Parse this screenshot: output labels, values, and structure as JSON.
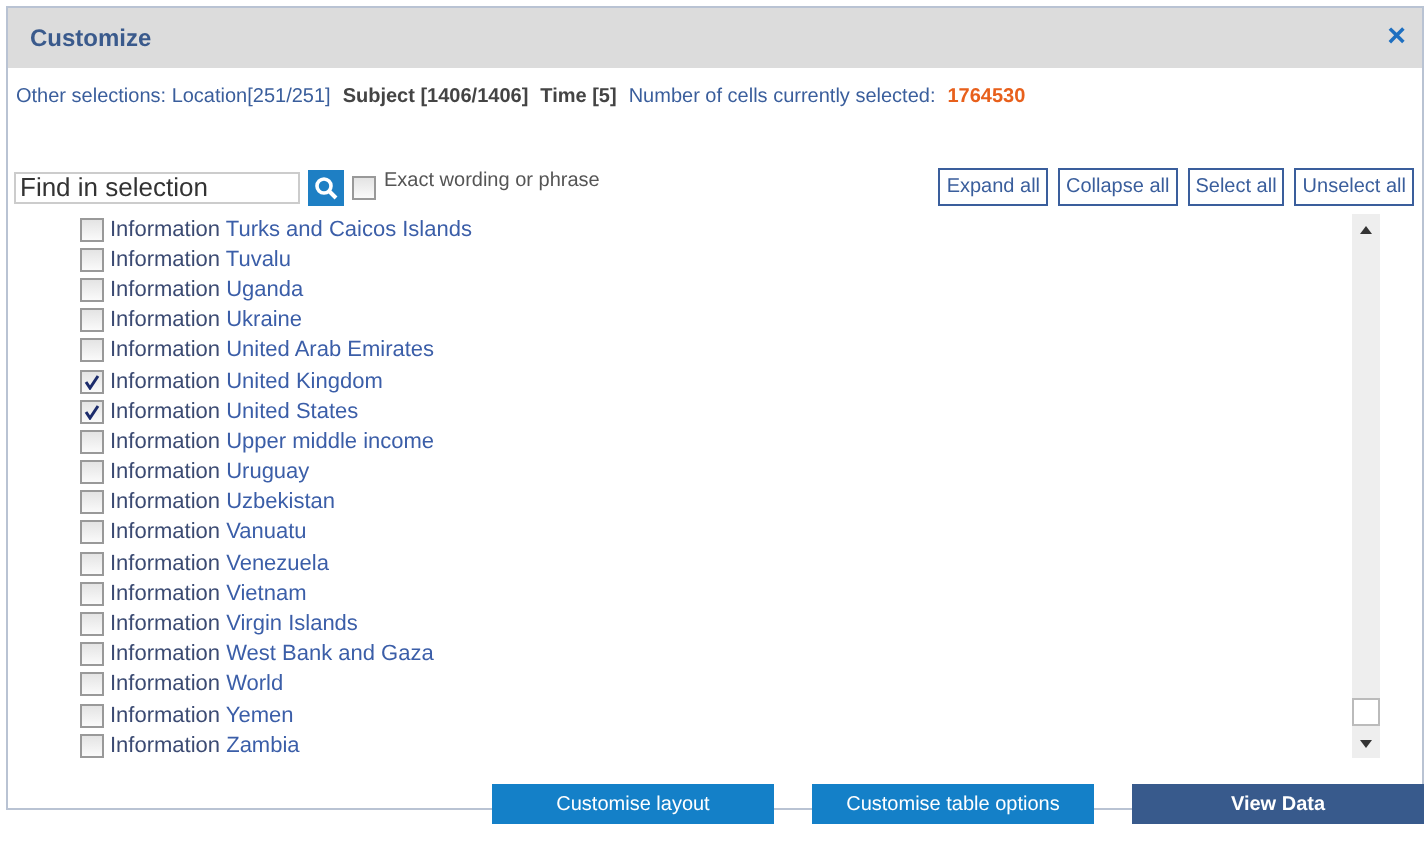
{
  "dialog": {
    "title": "Customize",
    "close": "×"
  },
  "selections": [
    {
      "kind": "plain",
      "text": "Other selections: Location[251/251]"
    },
    {
      "kind": "bold",
      "text": "Subject [1406/1406]"
    },
    {
      "kind": "bold",
      "text": "Time [5]"
    },
    {
      "kind": "plain",
      "text": "Number of cells currently selected:"
    },
    {
      "kind": "count",
      "text": "1764530"
    }
  ],
  "search": {
    "placeholder": "Find in selection",
    "exact_label": "Exact wording or phrase",
    "exact_checked": false
  },
  "actions": [
    "Expand all",
    "Collapse all",
    "Select all",
    "Unselect all"
  ],
  "items": [
    {
      "prefix": "Information",
      "name": "Turks and Caicos Islands",
      "checked": false
    },
    {
      "prefix": "Information",
      "name": "Tuvalu",
      "checked": false
    },
    {
      "prefix": "Information",
      "name": "Uganda",
      "checked": false
    },
    {
      "prefix": "Information",
      "name": "Ukraine",
      "checked": false
    },
    {
      "prefix": "Information",
      "name": "United Arab Emirates",
      "checked": false
    },
    {
      "prefix": "Information",
      "name": "United Kingdom",
      "checked": true
    },
    {
      "prefix": "Information",
      "name": "United States",
      "checked": true
    },
    {
      "prefix": "Information",
      "name": "Upper middle income",
      "checked": false
    },
    {
      "prefix": "Information",
      "name": "Uruguay",
      "checked": false
    },
    {
      "prefix": "Information",
      "name": "Uzbekistan",
      "checked": false
    },
    {
      "prefix": "Information",
      "name": "Vanuatu",
      "checked": false
    },
    {
      "prefix": "Information",
      "name": "Venezuela",
      "checked": false
    },
    {
      "prefix": "Information",
      "name": "Vietnam",
      "checked": false
    },
    {
      "prefix": "Information",
      "name": "Virgin Islands",
      "checked": false
    },
    {
      "prefix": "Information",
      "name": "West Bank and Gaza",
      "checked": false
    },
    {
      "prefix": "Information",
      "name": "World",
      "checked": false
    },
    {
      "prefix": "Information",
      "name": "Yemen",
      "checked": false
    },
    {
      "prefix": "Information",
      "name": "Zambia",
      "checked": false
    }
  ],
  "footer_buttons": [
    {
      "kind": "secondary",
      "label": "Customise layout"
    },
    {
      "kind": "secondary",
      "label": "Customise table options"
    },
    {
      "kind": "primary",
      "label": "View Data"
    }
  ]
}
